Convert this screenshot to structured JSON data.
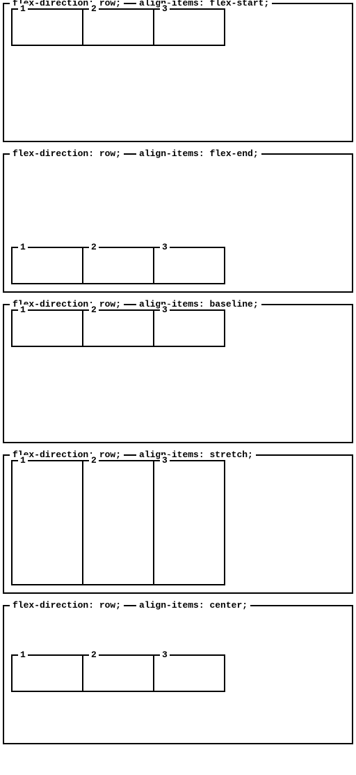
{
  "panels": [
    {
      "prop1": "flex-direction: row;",
      "prop2": "align-items: flex-start;",
      "align_class": "ai-flex-start",
      "stretch": false,
      "items": [
        "1",
        "2",
        "3"
      ]
    },
    {
      "prop1": "flex-direction: row;",
      "prop2": "align-items: flex-end;",
      "align_class": "ai-flex-end",
      "stretch": false,
      "items": [
        "1",
        "2",
        "3"
      ]
    },
    {
      "prop1": "flex-direction: row;",
      "prop2": "align-items: baseline;",
      "align_class": "ai-baseline",
      "stretch": false,
      "items": [
        "1",
        "2",
        "3"
      ]
    },
    {
      "prop1": "flex-direction: row;",
      "prop2": "align-items: stretch;",
      "align_class": "ai-stretch",
      "stretch": true,
      "items": [
        "1",
        "2",
        "3"
      ]
    },
    {
      "prop1": "flex-direction: row;",
      "prop2": "align-items: center;",
      "align_class": "ai-center",
      "stretch": false,
      "items": [
        "1",
        "2",
        "3"
      ]
    }
  ]
}
